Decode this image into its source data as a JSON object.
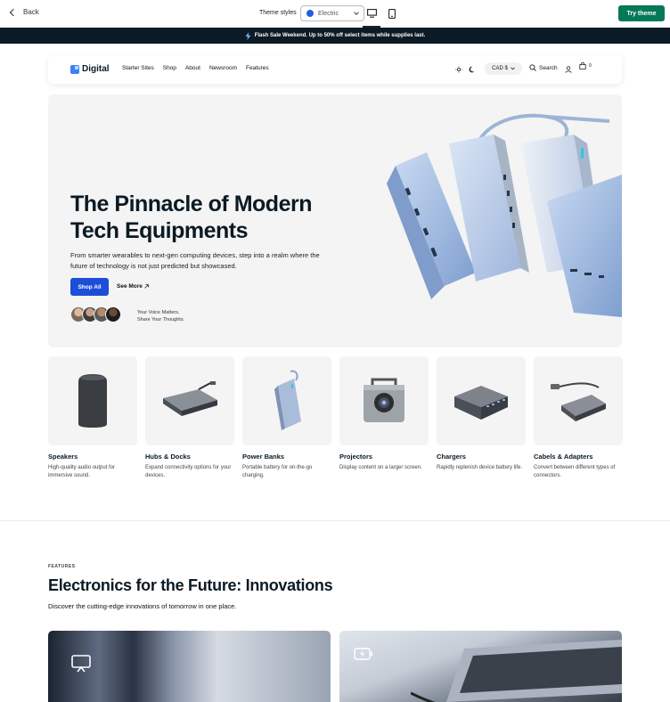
{
  "topbar": {
    "back_label": "Back",
    "theme_styles_label": "Theme styles",
    "theme_style_value": "Electric",
    "theme_style_color": "#1f5fe0",
    "try_theme_label": "Try theme"
  },
  "announcement": {
    "text": "Flash Sale Weekend. Up to 50% off select items while supplies last.",
    "icon": "lightning-icon"
  },
  "header": {
    "logo_text": "Digital",
    "nav": [
      "Starter Sites",
      "Shop",
      "About",
      "Newsroom",
      "Features"
    ],
    "currency": "CAD $",
    "search_label": "Search",
    "cart_count": "0"
  },
  "hero": {
    "title_line1": "The Pinnacle of Modern",
    "title_line2": "Tech Equipments",
    "subtitle": "From smarter wearables to next-gen computing devices, step into a realm where the future of technology is not just predicted but showcased.",
    "primary_cta": "Shop All",
    "secondary_cta": "See More",
    "voice_line1": "Your Voice Matters.",
    "voice_line2": "Share Your Thoughts."
  },
  "categories": [
    {
      "name": "Speakers",
      "desc": "High-quality audio output for immersive sound."
    },
    {
      "name": "Hubs & Docks",
      "desc": "Expand connectivity options for your devices."
    },
    {
      "name": "Power Banks",
      "desc": "Portable battery for on-the-go charging."
    },
    {
      "name": "Projectors",
      "desc": "Display content on a larger screen."
    },
    {
      "name": "Chargers",
      "desc": "Rapidly replenish device battery life."
    },
    {
      "name": "Cabels & Adapters",
      "desc": "Convert between different types of connectors."
    }
  ],
  "features": {
    "eyebrow": "FEATURES",
    "title": "Electronics for the Future: Innovations",
    "subtitle": "Discover the cutting-edge innovations of tomorrow in one place."
  },
  "colors": {
    "accent_blue": "#1d4ed8",
    "try_theme_green": "#047857",
    "announcement_bg": "#0b1a24"
  }
}
